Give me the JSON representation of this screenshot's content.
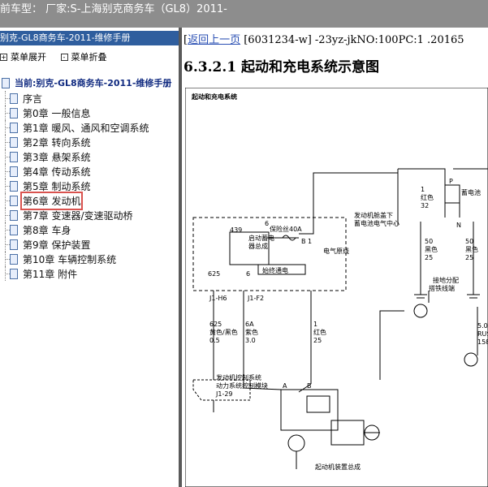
{
  "topbar": {
    "title": "前车型： 厂家:S-上海别克商务车（GL8）2011-"
  },
  "left": {
    "title": "别克-GL8商务车-2011-维修手册",
    "toolbar": {
      "expand": "菜单展开",
      "collapse": "菜单折叠"
    },
    "root": "当前:别克-GL8商务车-2011-维修手册",
    "items": [
      {
        "label": "序言"
      },
      {
        "label": "第0章 一般信息"
      },
      {
        "label": "第1章 暖风、通风和空调系统"
      },
      {
        "label": "第2章 转向系统"
      },
      {
        "label": "第3章 悬架系统"
      },
      {
        "label": "第4章 传动系统"
      },
      {
        "label": "第5章 制动系统"
      },
      {
        "label": "第6章 发动机"
      },
      {
        "label": "第7章 变速器/变速驱动桥"
      },
      {
        "label": "第8章 车身"
      },
      {
        "label": "第9章 保护装置"
      },
      {
        "label": "第10章 车辆控制系统"
      },
      {
        "label": "第11章 附件"
      }
    ]
  },
  "main": {
    "back_link": "返回上一页",
    "breadcrumb_rest": " [6031234-w] -23yz-jkNO:100PC:1 .20165",
    "heading": "6.3.2.1 起动和充电系统示意图",
    "diagram": {
      "title": "起动和充电系统",
      "fuse_box": "发动机舱盖下",
      "fuse_box_2": "蓄电池电气中心",
      "relay_label": "启动蓄电",
      "relay_label_2": "器总成",
      "fuse_label": "保险丝40A",
      "always_hot": "始终通电",
      "power_label": "电气原线",
      "battery": "蓄电池",
      "pin_439": "439",
      "pin_6": "6",
      "pin_b1": "B 1",
      "conn_625": "625",
      "conn_6": "6",
      "j1h6": "J1-H6",
      "j1f2": "J1-F2",
      "wire1a": "625",
      "wire1b": "黄色/黑色",
      "wire1c": "0.5",
      "wire2a": "6A",
      "wire2b": "紫色",
      "wire2c": "3.0",
      "wire3a": "1",
      "wire3b": "红色",
      "wire3c": "25",
      "wire4a": "1",
      "wire4b": "红色",
      "wire4c": "32",
      "wire5a": "50",
      "wire5b": "黑色",
      "wire5c": "25",
      "wire6a": "50",
      "wire6b": "黑色",
      "wire6c": "25",
      "ground_dist": "接地分配",
      "ecm": "发动机控制系统",
      "ecm2": "动力系统控制模块",
      "ecm3": "J1-29",
      "starter": "起动机装置总成",
      "clip": "搭铁线端",
      "rust": "5.0",
      "rust2": "RUST",
      "rust3": "158",
      "pa": "A",
      "pb": "B",
      "pp": "P",
      "pn": "N"
    }
  }
}
